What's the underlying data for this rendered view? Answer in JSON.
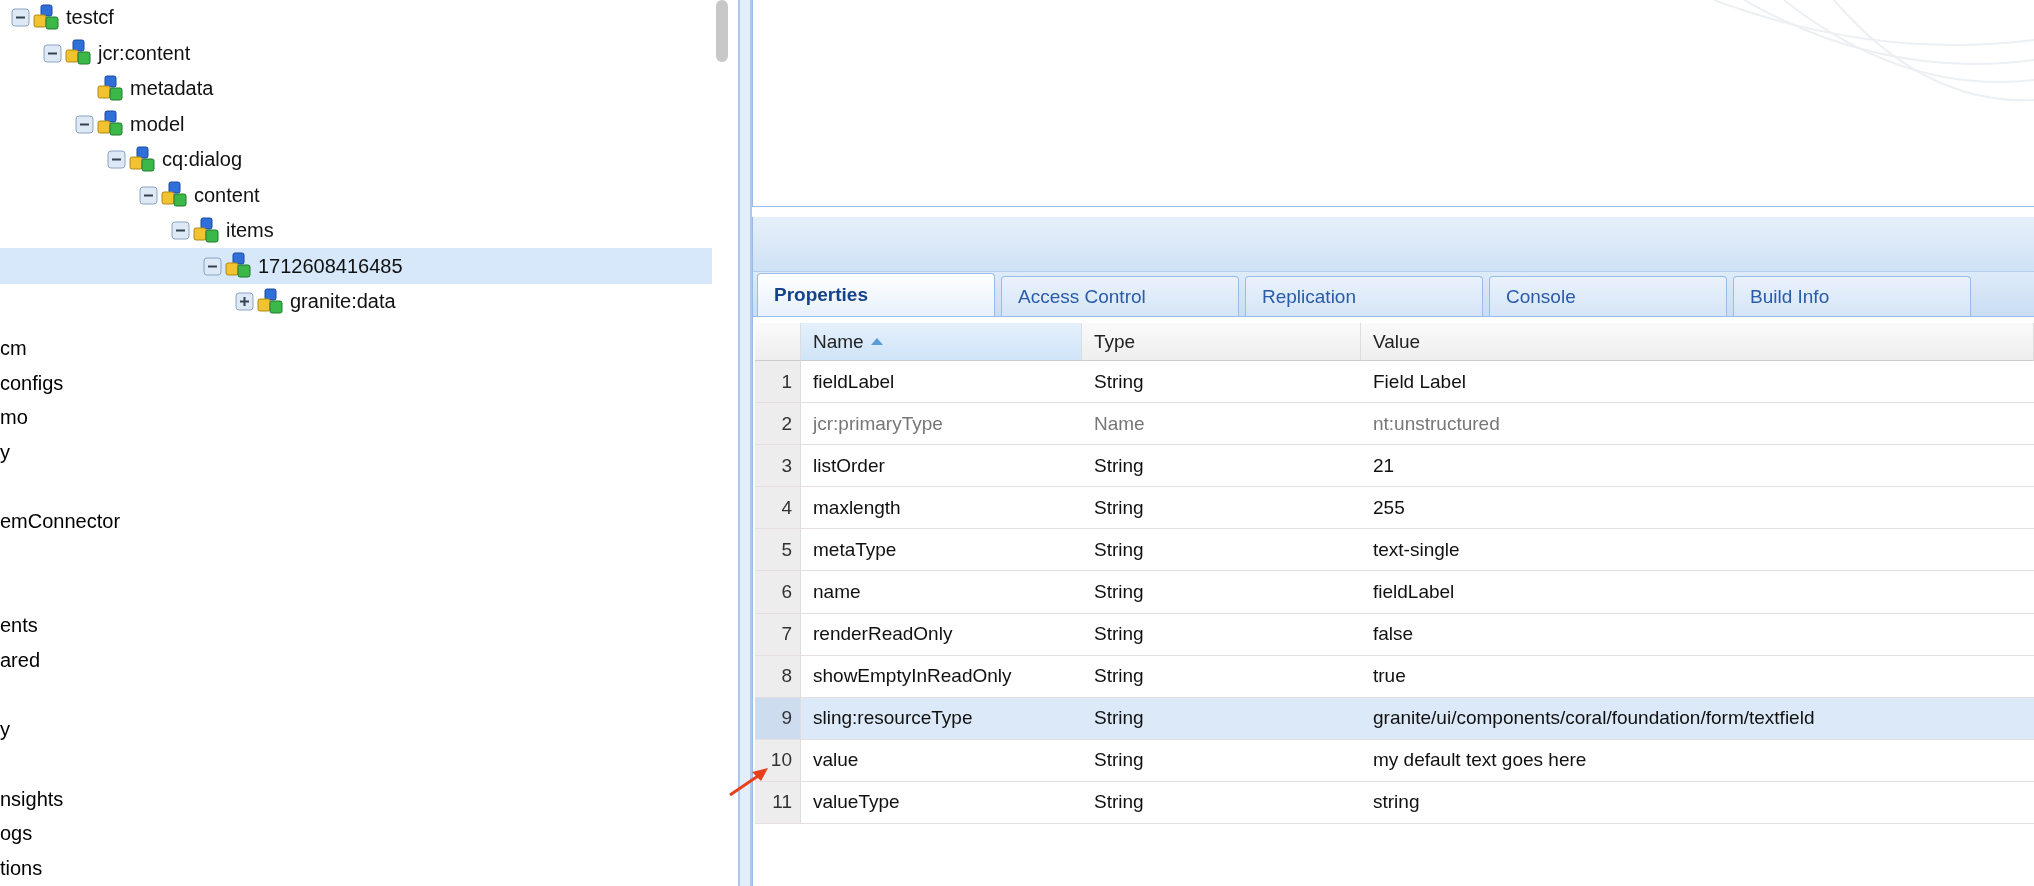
{
  "tree": {
    "nodes": [
      {
        "label": "testcf",
        "expanded": true,
        "selected": false,
        "children": [
          {
            "label": "jcr:content",
            "expanded": true,
            "selected": false,
            "children": [
              {
                "label": "metadata",
                "selected": false
              },
              {
                "label": "model",
                "expanded": true,
                "selected": false,
                "children": [
                  {
                    "label": "cq:dialog",
                    "expanded": true,
                    "selected": false,
                    "children": [
                      {
                        "label": "content",
                        "expanded": true,
                        "selected": false,
                        "children": [
                          {
                            "label": "items",
                            "expanded": true,
                            "selected": false,
                            "children": [
                              {
                                "label": "1712608416485",
                                "expanded": true,
                                "selected": true,
                                "children": [
                                  {
                                    "label": "granite:data",
                                    "expanded": false,
                                    "selected": false
                                  }
                                ]
                              }
                            ]
                          }
                        ]
                      }
                    ]
                  }
                ]
              }
            ]
          }
        ]
      }
    ]
  },
  "tree_partial_items": [
    "cm",
    "configs",
    "mo",
    "y",
    "emConnector",
    "ents",
    "ared",
    "y",
    "nsights",
    "ogs",
    "tions"
  ],
  "tabs": [
    {
      "label": "Properties",
      "selected": true
    },
    {
      "label": "Access Control",
      "selected": false
    },
    {
      "label": "Replication",
      "selected": false
    },
    {
      "label": "Console",
      "selected": false
    },
    {
      "label": "Build Info",
      "selected": false
    }
  ],
  "properties": {
    "columns": [
      {
        "label": "Name",
        "sorted": true
      },
      {
        "label": "Type",
        "sorted": false
      },
      {
        "label": "Value",
        "sorted": false
      }
    ],
    "rows": [
      {
        "number": "1",
        "name": "fieldLabel",
        "type": "String",
        "value": "Field Label",
        "protected": false,
        "selected": false
      },
      {
        "number": "2",
        "name": "jcr:primaryType",
        "type": "Name",
        "value": "nt:unstructured",
        "protected": true,
        "selected": false
      },
      {
        "number": "3",
        "name": "listOrder",
        "type": "String",
        "value": "21",
        "protected": false,
        "selected": false
      },
      {
        "number": "4",
        "name": "maxlength",
        "type": "String",
        "value": "255",
        "protected": false,
        "selected": false
      },
      {
        "number": "5",
        "name": "metaType",
        "type": "String",
        "value": "text-single",
        "protected": false,
        "selected": false
      },
      {
        "number": "6",
        "name": "name",
        "type": "String",
        "value": "fieldLabel",
        "protected": false,
        "selected": false
      },
      {
        "number": "7",
        "name": "renderReadOnly",
        "type": "String",
        "value": "false",
        "protected": false,
        "selected": false
      },
      {
        "number": "8",
        "name": "showEmptyInReadOnly",
        "type": "String",
        "value": "true",
        "protected": false,
        "selected": false
      },
      {
        "number": "9",
        "name": "sling:resourceType",
        "type": "String",
        "value": "granite/ui/components/coral/foundation/form/textfield",
        "protected": false,
        "selected": true
      },
      {
        "number": "10",
        "name": "value",
        "type": "String",
        "value": "my default text goes here",
        "protected": false,
        "selected": false
      },
      {
        "number": "11",
        "name": "valueType",
        "type": "String",
        "value": "string",
        "protected": false,
        "selected": false
      }
    ]
  }
}
